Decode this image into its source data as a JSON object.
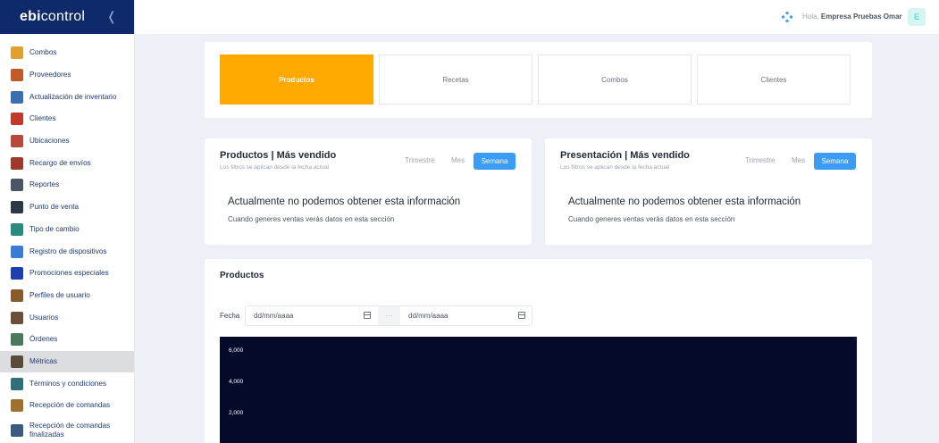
{
  "brand": {
    "name_bold": "ebi",
    "name_rest": "control",
    "collapse_icon": "chevron-left-icon"
  },
  "sidebar": {
    "items": [
      {
        "label": "Combos",
        "icon": "combos-icon",
        "color": "#e0a030"
      },
      {
        "label": "Proveedores",
        "icon": "truck-icon",
        "color": "#c05a28"
      },
      {
        "label": "Actualización de inventario",
        "icon": "inventory-icon",
        "color": "#3a6fb0"
      },
      {
        "label": "Clientes",
        "icon": "clients-icon",
        "color": "#c0392b"
      },
      {
        "label": "Ubicaciones",
        "icon": "location-icon",
        "color": "#b8483a"
      },
      {
        "label": "Recargo de envíos",
        "icon": "delivery-icon",
        "color": "#9b3a2a"
      },
      {
        "label": "Reportes",
        "icon": "reports-icon",
        "color": "#4a5568"
      },
      {
        "label": "Punto de venta",
        "icon": "pos-icon",
        "color": "#2d3748"
      },
      {
        "label": "Tipo de cambio",
        "icon": "exchange-icon",
        "color": "#2b8a7e"
      },
      {
        "label": "Registro de dispositivos",
        "icon": "devices-icon",
        "color": "#3a7bd5"
      },
      {
        "label": "Promociones especiales",
        "icon": "promotions-icon",
        "color": "#1e40af"
      },
      {
        "label": "Perfiles de usuario",
        "icon": "user-profile-icon",
        "color": "#8b5a2b"
      },
      {
        "label": "Usuarios",
        "icon": "users-icon",
        "color": "#6b4f3a"
      },
      {
        "label": "Órdenes",
        "icon": "orders-icon",
        "color": "#4a7a5a"
      },
      {
        "label": "Métricas",
        "icon": "metrics-icon",
        "color": "#5a4a3a",
        "active": true
      },
      {
        "label": "Términos y condiciones",
        "icon": "terms-icon",
        "color": "#2f6f7a"
      },
      {
        "label": "Recepción de comandas",
        "icon": "orders-reception-icon",
        "color": "#a07030"
      },
      {
        "label": "Recepción de comandas finalizadas",
        "icon": "finished-orders-icon",
        "color": "#3a5a80"
      }
    ]
  },
  "topbar": {
    "greeting": "Hola,",
    "company": "Empresa Pruebas Omar",
    "avatar_letter": "E"
  },
  "tabs": [
    "Productos",
    "Recetas",
    "Combos",
    "Clientes"
  ],
  "active_tab": "Productos",
  "colors": {
    "accent": "#ffa800",
    "primary": "#3b9bf5",
    "brand": "#0f2a6b",
    "chart_bg": "#050a2b"
  },
  "stats": [
    {
      "title": "Productos | Más vendido",
      "subtitle": "Los filtros se aplican desde la fecha actual",
      "filters": [
        "Trimestre",
        "Mes",
        "Semana"
      ],
      "active_filter": "Semana",
      "message": "Actualmente no podemos obtener esta información",
      "message_sub": "Cuando generes ventas verás datos en esta sección"
    },
    {
      "title": "Presentación | Más vendido",
      "subtitle": "Los filtros se aplican desde la fecha actual",
      "filters": [
        "Trimestre",
        "Mes",
        "Semana"
      ],
      "active_filter": "Semana",
      "message": "Actualmente no podemos obtener esta información",
      "message_sub": "Cuando generes ventas verás datos en esta sección"
    }
  ],
  "products": {
    "title": "Productos",
    "date_label": "Fecha",
    "start_placeholder": "dd/mm/aaaa",
    "separator": "···",
    "end_placeholder": "dd/mm/aaaa"
  },
  "chart_data": {
    "type": "bar",
    "yticks": [
      "6,000",
      "4,000",
      "2,000"
    ]
  }
}
